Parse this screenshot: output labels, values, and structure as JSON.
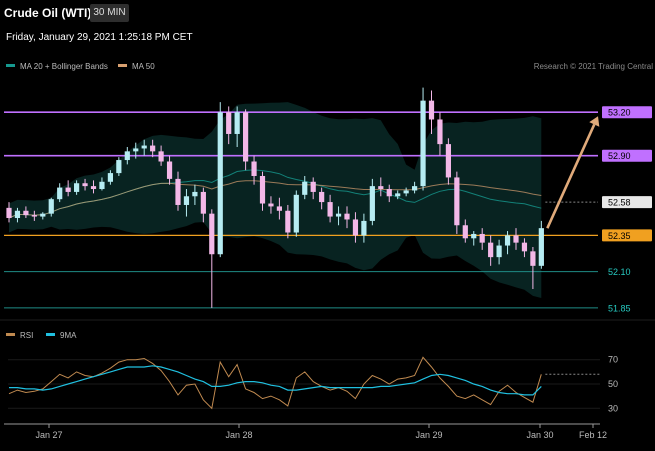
{
  "header": {
    "title": "Crude Oil (WTI)",
    "timeframe": "30 MIN",
    "datetime": "Friday, January 29, 2021 1:25:18 PM CET",
    "credit": "Research © 2021 Trading Central"
  },
  "colors": {
    "background": "#000000",
    "bull": "#b6ecf2",
    "bear": "#f3b8e8",
    "resistance": "#c070ff",
    "support": "#f0a020",
    "pivot_level": "#1f8c86",
    "ma20_bollinger": "#16998f",
    "ma50": "#d8a070",
    "rsi": "#c08a50",
    "rsi_ma": "#20c0e0",
    "arrow": "#e0aa7a"
  },
  "chart_data": [
    {
      "type": "candlestick",
      "legend": [
        "MA 20 + Bollinger Bands",
        "MA 50"
      ],
      "ylim": [
        51.78,
        53.45
      ],
      "x_labels": [
        "Jan 27",
        "Jan 28",
        "Jan 29",
        "Jan 30",
        "Feb 12"
      ],
      "levels": [
        {
          "value": 53.2,
          "label": "53.20",
          "kind": "resistance"
        },
        {
          "value": 52.9,
          "label": "52.90",
          "kind": "resistance"
        },
        {
          "value": 52.58,
          "label": "52.58",
          "kind": "current"
        },
        {
          "value": 52.35,
          "label": "52.35",
          "kind": "support"
        },
        {
          "value": 52.1,
          "label": "52.10",
          "kind": "pivot"
        },
        {
          "value": 51.85,
          "label": "51.85",
          "kind": "pivot"
        }
      ],
      "target": {
        "from_index": 63,
        "to_value": 53.2
      },
      "candles": [
        [
          52.54,
          52.58,
          52.44,
          52.47
        ],
        [
          52.47,
          52.54,
          52.44,
          52.52
        ],
        [
          52.52,
          52.55,
          52.47,
          52.49
        ],
        [
          52.49,
          52.52,
          52.45,
          52.48
        ],
        [
          52.48,
          52.51,
          52.46,
          52.5
        ],
        [
          52.5,
          52.61,
          52.48,
          52.6
        ],
        [
          52.6,
          52.71,
          52.58,
          52.68
        ],
        [
          52.68,
          52.73,
          52.62,
          52.65
        ],
        [
          52.65,
          52.73,
          52.63,
          52.71
        ],
        [
          52.71,
          52.74,
          52.66,
          52.69
        ],
        [
          52.69,
          52.73,
          52.64,
          52.67
        ],
        [
          52.67,
          52.75,
          52.66,
          52.72
        ],
        [
          52.72,
          52.8,
          52.7,
          52.78
        ],
        [
          52.78,
          52.89,
          52.76,
          52.87
        ],
        [
          52.87,
          52.96,
          52.84,
          52.93
        ],
        [
          52.93,
          52.99,
          52.88,
          52.95
        ],
        [
          52.95,
          53.01,
          52.9,
          52.97
        ],
        [
          52.97,
          53.01,
          52.89,
          52.93
        ],
        [
          52.93,
          52.97,
          52.83,
          52.86
        ],
        [
          52.86,
          52.9,
          52.7,
          52.74
        ],
        [
          52.74,
          52.79,
          52.52,
          52.56
        ],
        [
          52.56,
          52.67,
          52.48,
          52.62
        ],
        [
          52.62,
          52.7,
          52.56,
          52.65
        ],
        [
          52.65,
          52.68,
          52.44,
          52.5
        ],
        [
          52.5,
          52.53,
          51.85,
          52.22
        ],
        [
          52.22,
          53.27,
          52.2,
          53.2
        ],
        [
          53.2,
          53.24,
          52.98,
          53.05
        ],
        [
          53.05,
          53.24,
          52.96,
          53.2
        ],
        [
          53.2,
          53.22,
          52.8,
          52.86
        ],
        [
          52.86,
          52.9,
          52.7,
          52.76
        ],
        [
          52.76,
          52.79,
          52.52,
          52.57
        ],
        [
          52.57,
          52.62,
          52.5,
          52.55
        ],
        [
          52.55,
          52.61,
          52.46,
          52.52
        ],
        [
          52.52,
          52.56,
          52.33,
          52.37
        ],
        [
          52.37,
          52.66,
          52.34,
          52.63
        ],
        [
          52.63,
          52.76,
          52.6,
          52.72
        ],
        [
          52.72,
          52.75,
          52.6,
          52.65
        ],
        [
          52.65,
          52.68,
          52.53,
          52.58
        ],
        [
          52.58,
          52.63,
          52.44,
          52.48
        ],
        [
          52.48,
          52.55,
          52.42,
          52.5
        ],
        [
          52.5,
          52.55,
          52.4,
          52.46
        ],
        [
          52.46,
          52.51,
          52.3,
          52.35
        ],
        [
          52.35,
          52.5,
          52.3,
          52.45
        ],
        [
          52.45,
          52.74,
          52.42,
          52.69
        ],
        [
          52.69,
          52.75,
          52.62,
          52.67
        ],
        [
          52.67,
          52.7,
          52.58,
          52.62
        ],
        [
          52.62,
          52.66,
          52.6,
          52.64
        ],
        [
          52.64,
          52.68,
          52.62,
          52.66
        ],
        [
          52.66,
          52.72,
          52.64,
          52.69
        ],
        [
          52.69,
          53.37,
          52.66,
          53.28
        ],
        [
          53.28,
          53.35,
          53.05,
          53.15
        ],
        [
          53.15,
          53.2,
          52.9,
          52.98
        ],
        [
          52.98,
          53.02,
          52.7,
          52.75
        ],
        [
          52.75,
          52.79,
          52.36,
          52.42
        ],
        [
          52.42,
          52.46,
          52.3,
          52.33
        ],
        [
          52.33,
          52.38,
          52.28,
          52.36
        ],
        [
          52.36,
          52.4,
          52.25,
          52.3
        ],
        [
          52.3,
          52.35,
          52.14,
          52.2
        ],
        [
          52.2,
          52.32,
          52.15,
          52.28
        ],
        [
          52.28,
          52.38,
          52.22,
          52.35
        ],
        [
          52.35,
          52.4,
          52.25,
          52.3
        ],
        [
          52.3,
          52.33,
          52.2,
          52.24
        ],
        [
          52.24,
          52.27,
          51.98,
          52.14
        ],
        [
          52.14,
          52.45,
          52.12,
          52.4
        ]
      ]
    },
    {
      "type": "line",
      "legend": [
        "RSI",
        "9MA"
      ],
      "ylim": [
        22,
        78
      ],
      "y_ticks": [
        70,
        50,
        30
      ],
      "series": [
        {
          "name": "RSI",
          "values": [
            42,
            45,
            43,
            44,
            46,
            52,
            58,
            55,
            60,
            57,
            56,
            59,
            63,
            68,
            70,
            70,
            71,
            67,
            61,
            52,
            41,
            49,
            50,
            37,
            30,
            68,
            56,
            66,
            46,
            43,
            38,
            40,
            37,
            32,
            55,
            60,
            52,
            48,
            45,
            47,
            44,
            38,
            50,
            57,
            54,
            50,
            54,
            55,
            57,
            72,
            64,
            55,
            48,
            40,
            38,
            41,
            37,
            33,
            44,
            49,
            43,
            39,
            35,
            58
          ]
        },
        {
          "name": "9MA",
          "values": [
            47,
            47,
            46,
            46,
            45,
            46,
            48,
            50,
            52,
            54,
            56,
            58,
            60,
            62,
            64,
            64,
            64,
            65,
            64,
            62,
            60,
            57,
            54,
            52,
            48,
            48,
            49,
            51,
            52,
            52,
            51,
            49,
            48,
            45,
            45,
            46,
            47,
            48,
            47,
            47,
            47,
            47,
            47,
            47,
            48,
            48,
            49,
            50,
            51,
            54,
            57,
            58,
            57,
            55,
            53,
            50,
            48,
            45,
            43,
            42,
            42,
            41,
            41,
            48
          ]
        }
      ]
    }
  ]
}
